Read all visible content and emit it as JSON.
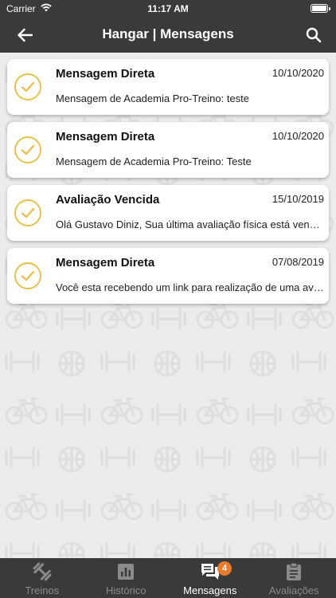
{
  "status_bar": {
    "carrier": "Carrier",
    "time": "11:17 AM"
  },
  "header": {
    "title": "Hangar | Mensagens"
  },
  "messages": [
    {
      "subject": "Mensagem Direta",
      "date": "10/10/2020",
      "preview": "Mensagem de Academia Pro-Treino:  teste"
    },
    {
      "subject": "Mensagem Direta",
      "date": "10/10/2020",
      "preview": "Mensagem de Academia Pro-Treino:  Teste"
    },
    {
      "subject": "Avaliação Vencida",
      "date": "15/10/2019",
      "preview": "Olá Gustavo Diniz,  Sua última avaliação física está vencida"
    },
    {
      "subject": "Mensagem Direta",
      "date": "07/08/2019",
      "preview": "Você esta recebendo um link para realização de uma avaliação"
    }
  ],
  "tabs": [
    {
      "label": "Treinos",
      "icon": "dumbbell-icon"
    },
    {
      "label": "Histórico",
      "icon": "bar-chart-icon"
    },
    {
      "label": "Mensagens",
      "icon": "chat-icon",
      "badge": "4"
    },
    {
      "label": "Avaliações",
      "icon": "clipboard-icon"
    }
  ],
  "colors": {
    "bar_background": "#3a3a3a",
    "check_accent": "#e7c14a",
    "badge": "#e87a2c",
    "content_background": "#ececec"
  }
}
